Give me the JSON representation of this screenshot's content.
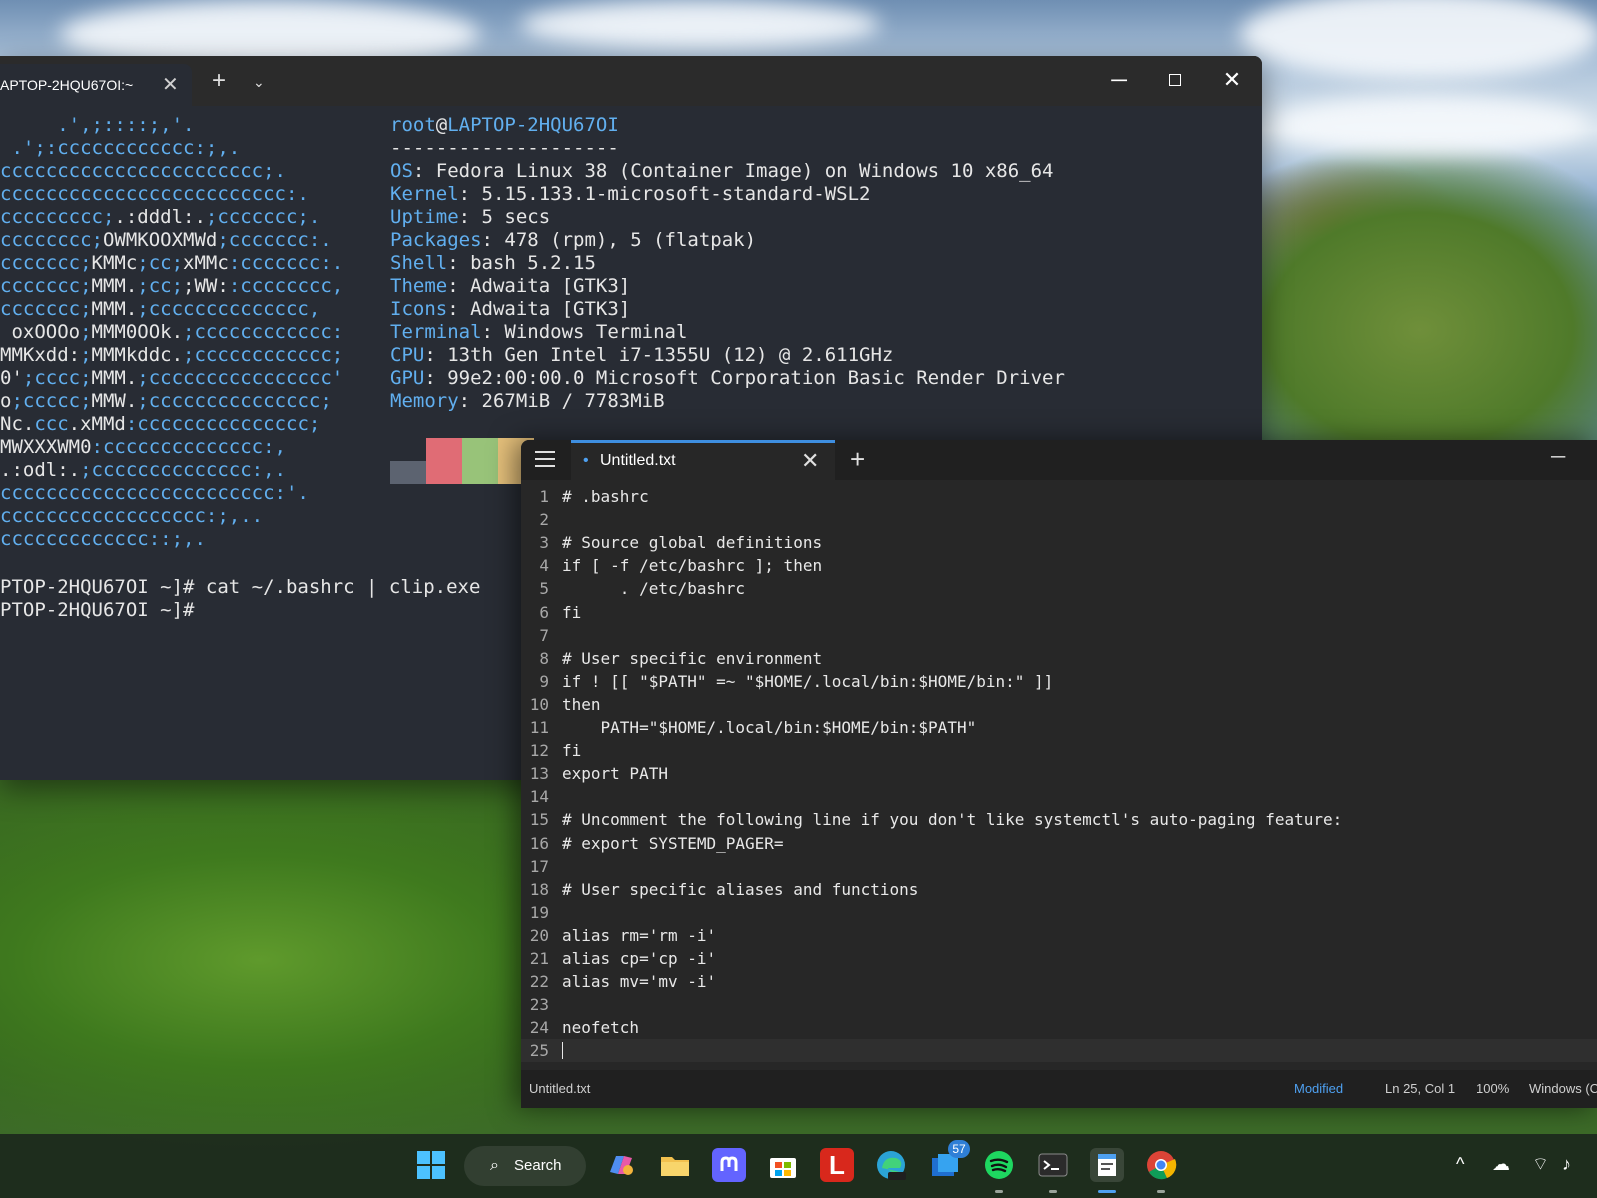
{
  "terminal": {
    "tab_title": "APTOP-2HQU67OI:~",
    "new_tab": "+",
    "dropdown": "⌄",
    "minimize": "─",
    "close": "✕",
    "ascii_art": [
      [
        {
          "t": "     .',;::::;,'."
        }
      ],
      [
        {
          "t": " .';:cccccccccccc:;,."
        }
      ],
      [
        {
          "t": "ccccccccccccccccccccccc;."
        }
      ],
      [
        {
          "t": "ccccccccccccccccccccccccc:."
        }
      ],
      [
        {
          "t": "ccccccccc;"
        },
        {
          "t": ".:dddl:.",
          "w": 1
        },
        {
          "t": ";ccccccc;."
        }
      ],
      [
        {
          "t": "cccccccc;"
        },
        {
          "t": "OWMKOOXMWd",
          "w": 1
        },
        {
          "t": ";ccccccc:."
        }
      ],
      [
        {
          "t": "ccccccc;"
        },
        {
          "t": "KMMc",
          "w": 1
        },
        {
          "t": ";cc;"
        },
        {
          "t": "xMMc",
          "w": 1
        },
        {
          "t": ":ccccccc:."
        }
      ],
      [
        {
          "t": "ccccccc;"
        },
        {
          "t": "MMM.",
          "w": 1
        },
        {
          "t": ";cc;"
        },
        {
          "t": ";WW:",
          "w": 1
        },
        {
          "t": ":cccccccc,"
        }
      ],
      [
        {
          "t": "ccccccc;"
        },
        {
          "t": "MMM.",
          "w": 1
        },
        {
          "t": ";cccccccccccccc,"
        }
      ],
      [
        {
          "t": " oxOOOo",
          "w": 1
        },
        {
          "t": ";"
        },
        {
          "t": "MMM0OOk.",
          "w": 1
        },
        {
          "t": ";cccccccccccc:"
        }
      ],
      [
        {
          "t": "MMKxdd:",
          "w": 1
        },
        {
          "t": ";"
        },
        {
          "t": "MMMkddc.",
          "w": 1
        },
        {
          "t": ";cccccccccccc;"
        }
      ],
      [
        {
          "t": "0'",
          "w": 1
        },
        {
          "t": ";cccc;"
        },
        {
          "t": "MMM.",
          "w": 1
        },
        {
          "t": ";cccccccccccccccc'"
        }
      ],
      [
        {
          "t": "o",
          "w": 1
        },
        {
          "t": ";ccccc;"
        },
        {
          "t": "MMW.",
          "w": 1
        },
        {
          "t": ";ccccccccccccccc;"
        }
      ],
      [
        {
          "t": "Nc.",
          "w": 1
        },
        {
          "t": "ccc"
        },
        {
          "t": ".xMMd",
          "w": 1
        },
        {
          "t": ":ccccccccccccccc;"
        }
      ],
      [
        {
          "t": "MWXXXWM0",
          "w": 1
        },
        {
          "t": ":cccccccccccccc:,"
        }
      ],
      [
        {
          "t": ".:odl:.",
          "w": 1
        },
        {
          "t": ";cccccccccccccc:,."
        }
      ],
      [
        {
          "t": "cccccccccccccccccccccccc:'."
        }
      ],
      [
        {
          "t": "cccccccccccccccccc:;,.."
        }
      ],
      [
        {
          "t": "ccccccccccccc::;,."
        }
      ]
    ],
    "info_lines": [
      [
        {
          "t": "root",
          "k": 1
        },
        {
          "t": "@"
        },
        {
          "t": "LAPTOP-2HQU67OI",
          "k": 1
        }
      ],
      [
        {
          "t": "--------------------"
        }
      ],
      [
        {
          "t": "OS",
          "k": 1
        },
        {
          "t": ": Fedora Linux 38 (Container Image) on Windows 10 x86_64"
        }
      ],
      [
        {
          "t": "Kernel",
          "k": 1
        },
        {
          "t": ": 5.15.133.1-microsoft-standard-WSL2"
        }
      ],
      [
        {
          "t": "Uptime",
          "k": 1
        },
        {
          "t": ": 5 secs"
        }
      ],
      [
        {
          "t": "Packages",
          "k": 1
        },
        {
          "t": ": 478 (rpm), 5 (flatpak)"
        }
      ],
      [
        {
          "t": "Shell",
          "k": 1
        },
        {
          "t": ": bash 5.2.15"
        }
      ],
      [
        {
          "t": "Theme",
          "k": 1
        },
        {
          "t": ": Adwaita [GTK3]"
        }
      ],
      [
        {
          "t": "Icons",
          "k": 1
        },
        {
          "t": ": Adwaita [GTK3]"
        }
      ],
      [
        {
          "t": "Terminal",
          "k": 1
        },
        {
          "t": ": Windows Terminal"
        }
      ],
      [
        {
          "t": "CPU",
          "k": 1
        },
        {
          "t": ": 13th Gen Intel i7-1355U (12) @ 2.611GHz"
        }
      ],
      [
        {
          "t": "GPU",
          "k": 1
        },
        {
          "t": ": 99e2:00:00.0 Microsoft Corporation Basic Render Driver"
        }
      ],
      [
        {
          "t": "Memory",
          "k": 1
        },
        {
          "t": ": 267MiB / 7783MiB"
        }
      ]
    ],
    "palette_colors": [
      "#5c6370",
      "#e06c75",
      "#98c379",
      "#e5c07b"
    ],
    "prompt_lines": [
      "PTOP-2HQU67OI ~]# cat ~/.bashrc | clip.exe",
      "PTOP-2HQU67OI ~]#"
    ]
  },
  "notepad": {
    "tab_title": "Untitled.txt",
    "modified_dot": "•",
    "close": "✕",
    "new_tab": "+",
    "minimize": "─",
    "lines": [
      "# .bashrc",
      "",
      "# Source global definitions",
      "if [ -f /etc/bashrc ]; then",
      "      . /etc/bashrc",
      "fi",
      "",
      "# User specific environment",
      "if ! [[ \"$PATH\" =~ \"$HOME/.local/bin:$HOME/bin:\" ]]",
      "then",
      "    PATH=\"$HOME/.local/bin:$HOME/bin:$PATH\"",
      "fi",
      "export PATH",
      "",
      "# Uncomment the following line if you don't like systemctl's auto-paging feature:",
      "# export SYSTEMD_PAGER=",
      "",
      "# User specific aliases and functions",
      "",
      "alias rm='rm -i'",
      "alias cp='cp -i'",
      "alias mv='mv -i'",
      "",
      "neofetch",
      ""
    ],
    "status": {
      "filename": "Untitled.txt",
      "modified": "Modified",
      "position": "Ln 25, Col 1",
      "zoom": "100%",
      "line_ending": "Windows (C"
    }
  },
  "taskbar": {
    "search_label": "Search",
    "search_icon": "⌕",
    "mail_badge": "57",
    "tray_chevron": "^",
    "tray_cloud": "☁",
    "tray_wifi": "⌔",
    "tray_volume": "♪",
    "lexis_letter": "L"
  },
  "colors": {
    "terminal_bg": "#282c34",
    "terminal_accent": "#61afef",
    "notepad_bg": "#272727",
    "status_modified": "#4ea0f0",
    "tab_accent": "#3e8ee0"
  }
}
